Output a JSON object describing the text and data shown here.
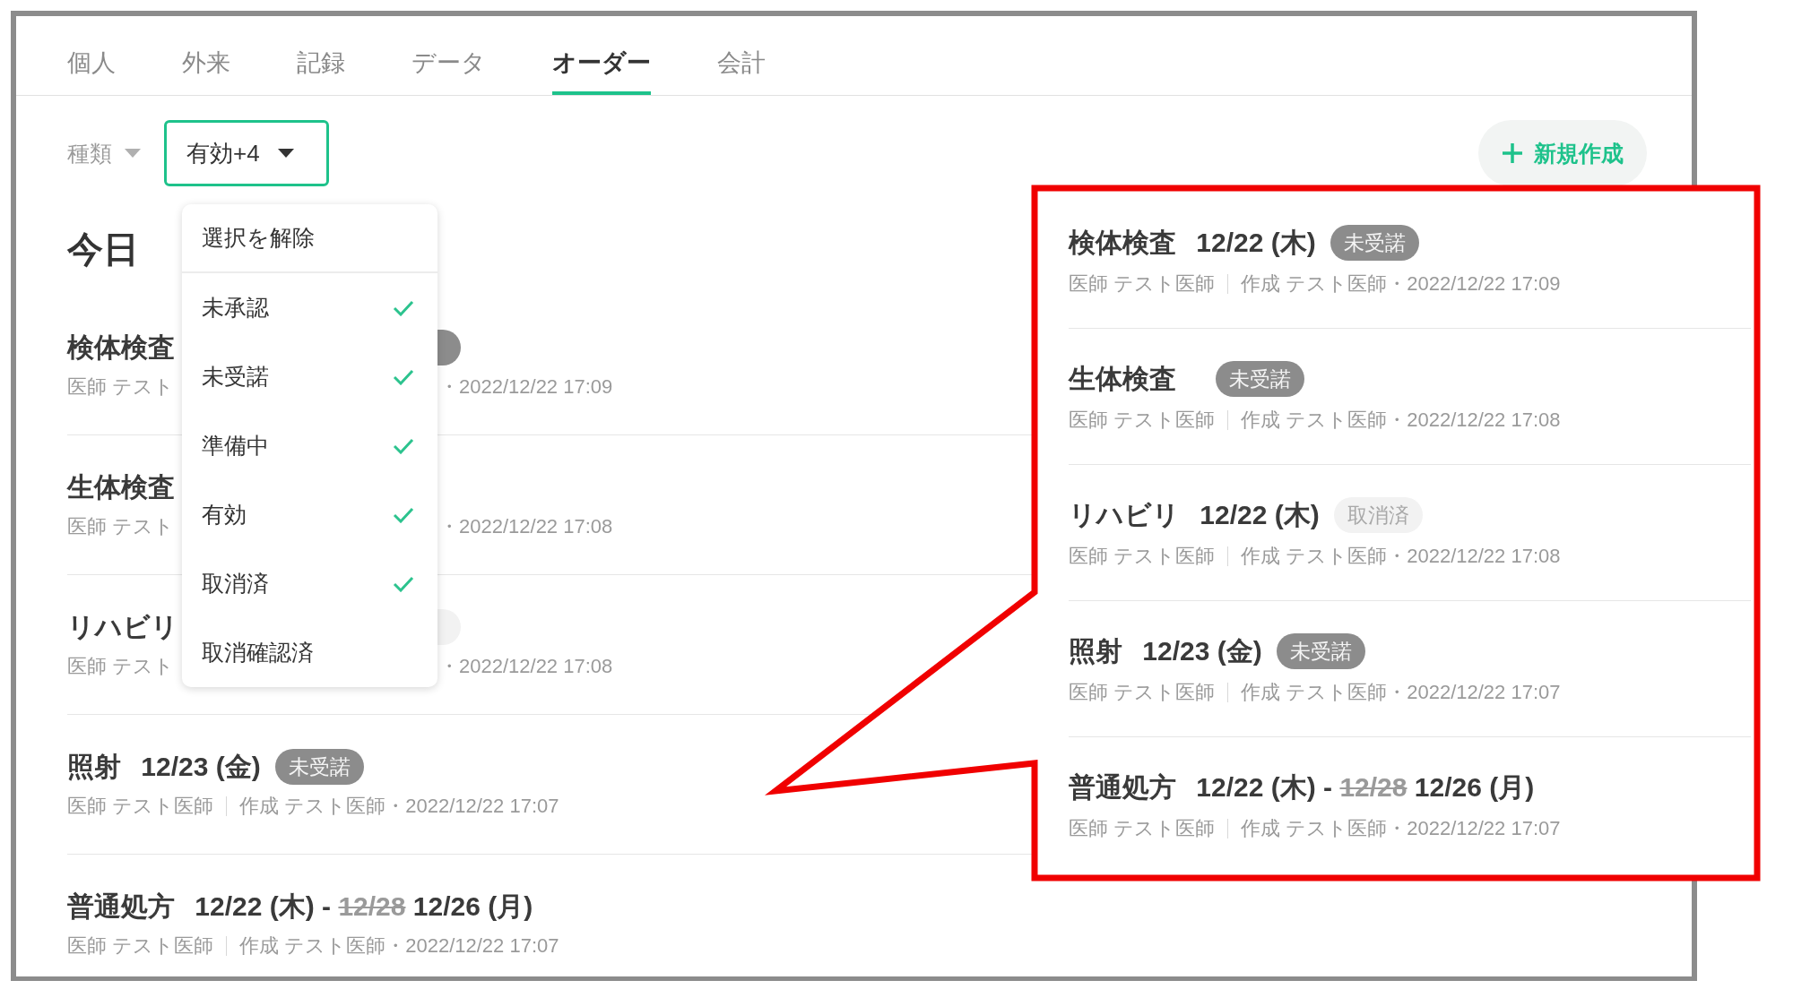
{
  "tabs": [
    {
      "label": "個人",
      "selected": false
    },
    {
      "label": "外来",
      "selected": false
    },
    {
      "label": "記録",
      "selected": false
    },
    {
      "label": "データ",
      "selected": false
    },
    {
      "label": "オーダー",
      "selected": true
    },
    {
      "label": "会計",
      "selected": false
    }
  ],
  "filters": {
    "type_filter": {
      "label": "種類"
    },
    "status_filter": {
      "label": "有効+4",
      "expanded": true
    }
  },
  "new_button": {
    "label": "新規作成"
  },
  "status_menu": {
    "clear_label": "選択を解除",
    "options": [
      {
        "label": "未承認",
        "checked": true
      },
      {
        "label": "未受諾",
        "checked": true
      },
      {
        "label": "準備中",
        "checked": true
      },
      {
        "label": "有効",
        "checked": true
      },
      {
        "label": "取消済",
        "checked": true
      },
      {
        "label": "取消確認済",
        "checked": false
      }
    ]
  },
  "section_title": "今日",
  "orders": [
    {
      "kind": "partly_hidden",
      "name": "検体検査",
      "meta_start": "医師 テスト",
      "meta_end": "・2022/12/22 17:09",
      "badge_fragment": {
        "color": "#8c8c8c"
      }
    },
    {
      "kind": "partly_hidden",
      "name": "生体検査",
      "meta_start": "医師 テスト",
      "meta_end": "・2022/12/22 17:08"
    },
    {
      "kind": "partly_hidden",
      "name": "リハビリ",
      "meta_start": "医師 テスト",
      "meta_end": "・2022/12/22 17:08",
      "badge_fragment": {
        "color": "#f2f2f2"
      }
    },
    {
      "kind": "full",
      "name": "照射",
      "date": "12/23 (金)",
      "status": {
        "label": "未受諾",
        "kind": "pending"
      },
      "doctor": "医師 テスト医師",
      "created": "作成 テスト医師・2022/12/22 17:07"
    },
    {
      "kind": "full",
      "name": "普通処方",
      "date": "12/22 (木) -",
      "old_end": "12/28",
      "new_end": "12/26 (月)",
      "doctor": "医師 テスト医師",
      "created": "作成 テスト医師・2022/12/22 17:07"
    }
  ],
  "callout": {
    "orders": [
      {
        "kind": "full",
        "name": "検体検査",
        "date": "12/22 (木)",
        "status": {
          "label": "未受諾",
          "kind": "pending"
        },
        "doctor": "医師 テスト医師",
        "created": "作成 テスト医師・2022/12/22 17:09"
      },
      {
        "kind": "full",
        "name": "生体検査",
        "status": {
          "label": "未受諾",
          "kind": "pending"
        },
        "doctor": "医師 テスト医師",
        "created": "作成 テスト医師・2022/12/22 17:08"
      },
      {
        "kind": "full",
        "name": "リハビリ",
        "date": "12/22 (木)",
        "status": {
          "label": "取消済",
          "kind": "cancelled"
        },
        "doctor": "医師 テスト医師",
        "created": "作成 テスト医師・2022/12/22 17:08"
      },
      {
        "kind": "full",
        "name": "照射",
        "date": "12/23 (金)",
        "status": {
          "label": "未受諾",
          "kind": "pending"
        },
        "doctor": "医師 テスト医師",
        "created": "作成 テスト医師・2022/12/22 17:07"
      },
      {
        "kind": "full",
        "name": "普通処方",
        "date": "12/22 (木) -",
        "old_end": "12/28",
        "new_end": "12/26 (月)",
        "doctor": "医師 テスト医師",
        "created": "作成 テスト医師・2022/12/22 17:07"
      }
    ]
  }
}
